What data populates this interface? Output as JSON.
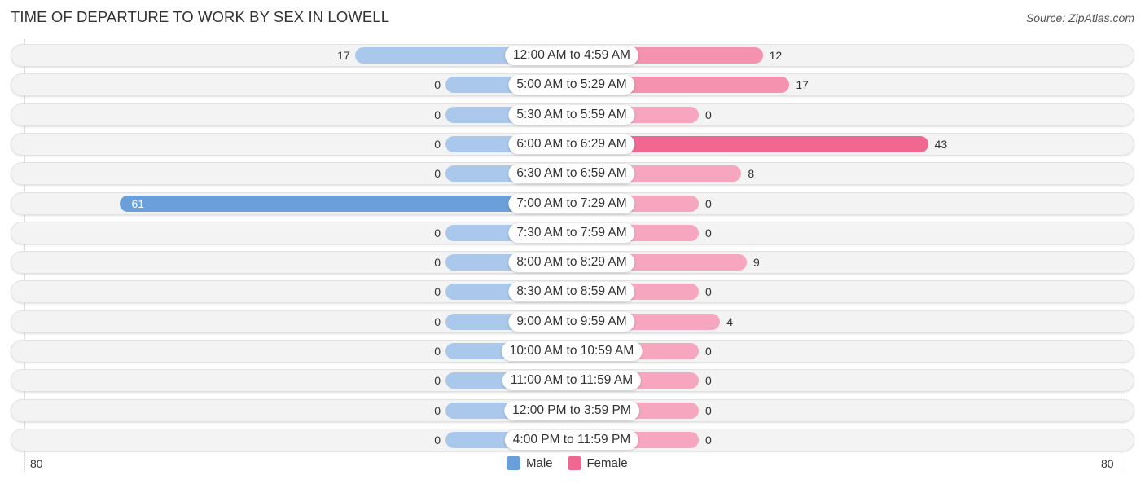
{
  "header": {
    "title": "TIME OF DEPARTURE TO WORK BY SEX IN LOWELL",
    "source": "Source: ZipAtlas.com"
  },
  "colors": {
    "male": "#a9c8eb",
    "male_strong": "#6a9fd9",
    "female": "#f7a6bf",
    "female_strong": "#f06891"
  },
  "chart_data": {
    "type": "bar",
    "orientation": "horizontal-diverging",
    "title": "TIME OF DEPARTURE TO WORK BY SEX IN LOWELL",
    "categories": [
      "12:00 AM to 4:59 AM",
      "5:00 AM to 5:29 AM",
      "5:30 AM to 5:59 AM",
      "6:00 AM to 6:29 AM",
      "6:30 AM to 6:59 AM",
      "7:00 AM to 7:29 AM",
      "7:30 AM to 7:59 AM",
      "8:00 AM to 8:29 AM",
      "8:30 AM to 8:59 AM",
      "9:00 AM to 9:59 AM",
      "10:00 AM to 10:59 AM",
      "11:00 AM to 11:59 AM",
      "12:00 PM to 3:59 PM",
      "4:00 PM to 11:59 PM"
    ],
    "series": [
      {
        "name": "Male",
        "values": [
          17,
          0,
          0,
          0,
          0,
          61,
          0,
          0,
          0,
          0,
          0,
          0,
          0,
          0
        ]
      },
      {
        "name": "Female",
        "values": [
          12,
          17,
          0,
          43,
          8,
          0,
          0,
          9,
          0,
          4,
          0,
          0,
          0,
          0
        ]
      }
    ],
    "axis": {
      "left_label": "80",
      "right_label": "80",
      "range": [
        -80,
        80
      ]
    },
    "legend": {
      "position": "bottom-center",
      "entries": [
        "Male",
        "Female"
      ]
    },
    "grid": false
  }
}
